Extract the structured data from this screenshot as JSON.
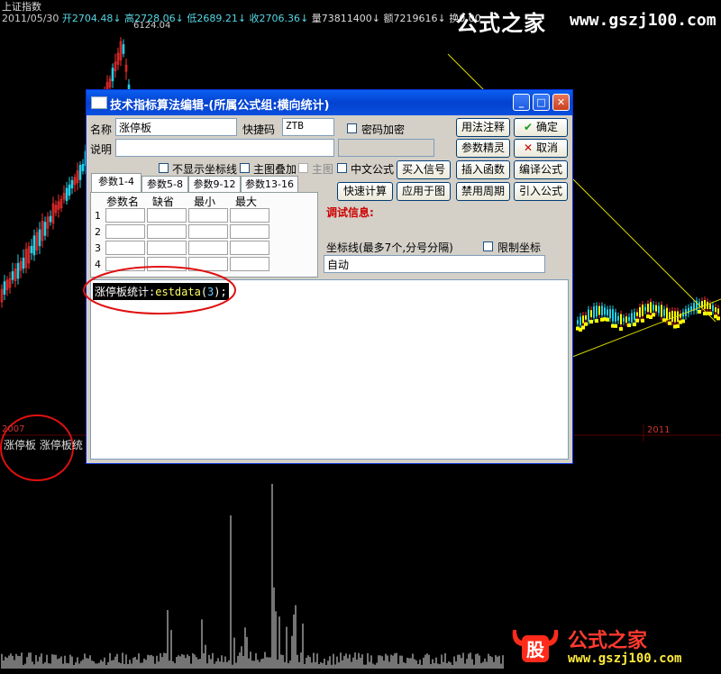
{
  "chart": {
    "index_name": "上证指数",
    "date": "2011/05/30",
    "open_label": "开2704.48",
    "high_label": "高2728.06",
    "low_label": "低2689.21",
    "close_label": "收2706.36",
    "volume_label": "量73811400",
    "amount_label": "额7219616",
    "turnover_label": "换0.00",
    "peak_label": "6124.04",
    "sub_label": "涨停板 涨停板统",
    "year_left": "2007",
    "year_right": "2011",
    "colors": {
      "up": "#ff3030",
      "down": "#22d0e8",
      "yellow": "#ffff00",
      "trend": "#c8c800"
    }
  },
  "brand": {
    "name": "公式之家",
    "site": "www.gszj100.com"
  },
  "watermark": {
    "name": "公式之家",
    "site": "www.gszj100.com",
    "logo_char": "股"
  },
  "dialog": {
    "title": "技术指标算法编辑-(所属公式组:横向统计)",
    "name_label": "名称",
    "name_value": "涨停板",
    "shortcut_label": "快捷码",
    "shortcut_value": "ZTB",
    "password_label": "密码加密",
    "desc_label": "说明",
    "desc_value": "",
    "hide_axis_label": "不显示坐标线",
    "main_overlay_label": "主图叠加",
    "main_chart_label": "主图",
    "chinese_formula_label": "中文公式",
    "buttons": {
      "usage": "用法注释",
      "ok": "确定",
      "param_wizard": "参数精灵",
      "cancel": "取消",
      "buy_signal": "买入信号",
      "insert_func": "插入函数",
      "compile": "编译公式",
      "quick_calc": "快速计算",
      "apply": "应用于图",
      "disable_period": "禁用周期",
      "import": "引入公式"
    },
    "tabs": [
      "参数1-4",
      "参数5-8",
      "参数9-12",
      "参数13-16"
    ],
    "param_headers": [
      "参数名",
      "缺省",
      "最小",
      "最大"
    ],
    "param_rows": [
      "1",
      "2",
      "3",
      "4"
    ],
    "debug_label": "调试信息:",
    "axis_label": "坐标线(最多7个,分号分隔)",
    "limit_axis_label": "限制坐标",
    "axis_value": "自动",
    "code": {
      "prefix": "涨停板统计:",
      "func": "estdata",
      "open": "(",
      "arg": "3",
      "close": ");"
    }
  }
}
